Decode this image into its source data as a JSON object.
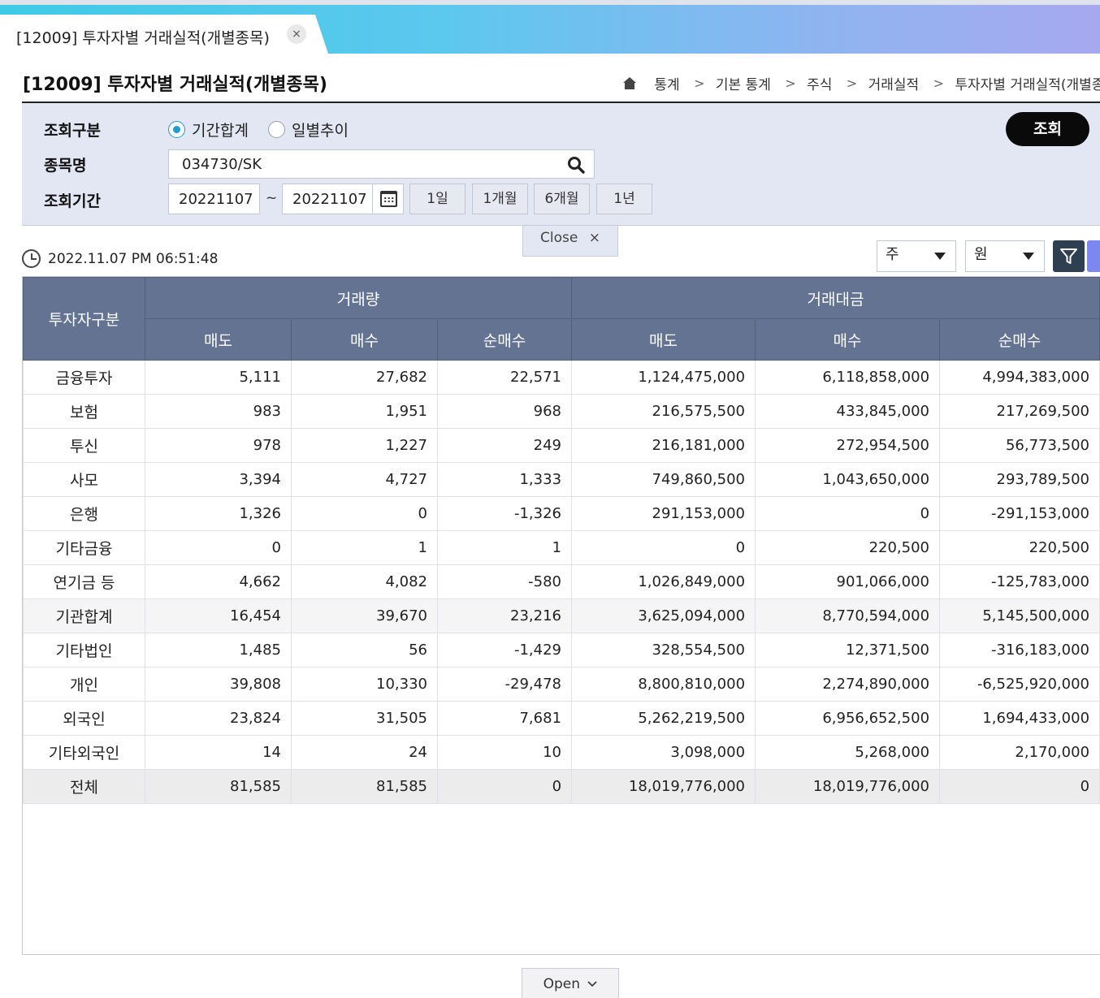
{
  "tab": {
    "title": "[12009] 투자자별 거래실적(개별종목)",
    "close": "×"
  },
  "page": {
    "title": "[12009] 투자자별 거래실적(개별종목)"
  },
  "breadcrumb": [
    "통계",
    "기본 통계",
    "주식",
    "거래실적",
    "투자자별 거래실적(개별종목)"
  ],
  "search": {
    "type_label": "조회구분",
    "type_options": [
      "기간합계",
      "일별추이"
    ],
    "type_selected": "기간합계",
    "stock_label": "종목명",
    "stock_value": "034730/SK",
    "period_label": "조회기간",
    "date_from": "20221107",
    "date_sep": "~",
    "date_to": "20221107",
    "period_buttons": [
      "1일",
      "1개월",
      "6개월",
      "1년"
    ],
    "query_button": "조회",
    "close_toggle": "Close",
    "close_icon": "×"
  },
  "toolbar": {
    "timestamp": "2022.11.07 PM 06:51:48",
    "unit_volume": "주",
    "unit_amount": "원"
  },
  "table": {
    "header_investor": "투자자구분",
    "group_volume": "거래량",
    "group_amount": "거래대금",
    "sub_headers": [
      "매도",
      "매수",
      "순매수",
      "매도",
      "매수",
      "순매수"
    ],
    "rows": [
      {
        "cat": "금융투자",
        "v": [
          "5,111",
          "27,682",
          "22,571",
          "1,124,475,000",
          "6,118,858,000",
          "4,994,383,000"
        ]
      },
      {
        "cat": "보험",
        "v": [
          "983",
          "1,951",
          "968",
          "216,575,500",
          "433,845,000",
          "217,269,500"
        ]
      },
      {
        "cat": "투신",
        "v": [
          "978",
          "1,227",
          "249",
          "216,181,000",
          "272,954,500",
          "56,773,500"
        ]
      },
      {
        "cat": "사모",
        "v": [
          "3,394",
          "4,727",
          "1,333",
          "749,860,500",
          "1,043,650,000",
          "293,789,500"
        ]
      },
      {
        "cat": "은행",
        "v": [
          "1,326",
          "0",
          "-1,326",
          "291,153,000",
          "0",
          "-291,153,000"
        ]
      },
      {
        "cat": "기타금융",
        "v": [
          "0",
          "1",
          "1",
          "0",
          "220,500",
          "220,500"
        ]
      },
      {
        "cat": "연기금 등",
        "v": [
          "4,662",
          "4,082",
          "-580",
          "1,026,849,000",
          "901,066,000",
          "-125,783,000"
        ]
      },
      {
        "cat": "기관합계",
        "v": [
          "16,454",
          "39,670",
          "23,216",
          "3,625,094,000",
          "8,770,594,000",
          "5,145,500,000"
        ]
      },
      {
        "cat": "기타법인",
        "v": [
          "1,485",
          "56",
          "-1,429",
          "328,554,500",
          "12,371,500",
          "-316,183,000"
        ]
      },
      {
        "cat": "개인",
        "v": [
          "39,808",
          "10,330",
          "-29,478",
          "8,800,810,000",
          "2,274,890,000",
          "-6,525,920,000"
        ]
      },
      {
        "cat": "외국인",
        "v": [
          "23,824",
          "31,505",
          "7,681",
          "5,262,219,500",
          "6,956,652,500",
          "1,694,433,000"
        ]
      },
      {
        "cat": "기타외국인",
        "v": [
          "14",
          "24",
          "10",
          "3,098,000",
          "5,268,000",
          "2,170,000"
        ]
      },
      {
        "cat": "전체",
        "v": [
          "81,585",
          "81,585",
          "0",
          "18,019,776,000",
          "18,019,776,000",
          "0"
        ]
      }
    ]
  },
  "footer": {
    "open_toggle": "Open"
  }
}
